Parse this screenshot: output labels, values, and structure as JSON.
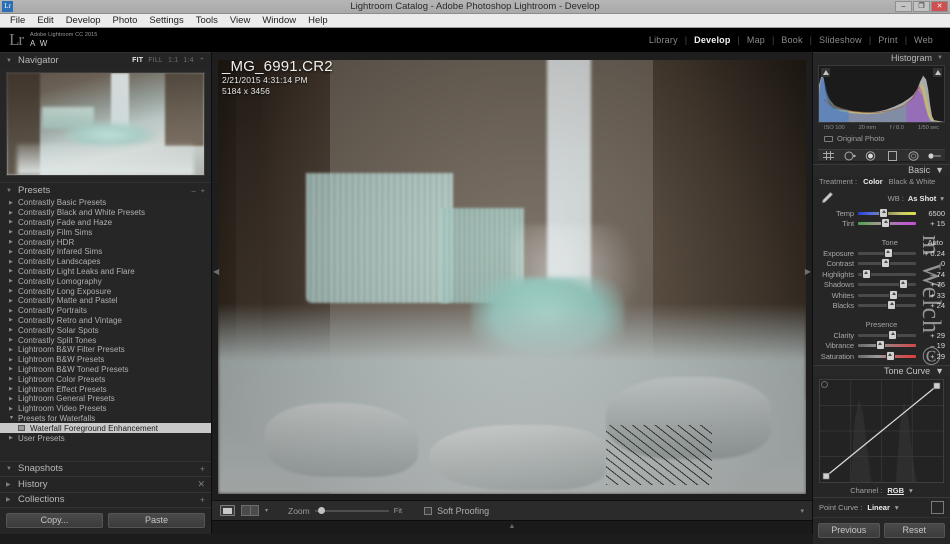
{
  "window": {
    "title": "Lightroom Catalog - Adobe Photoshop Lightroom - Develop",
    "app_icon": "Lr",
    "minimize": "–",
    "maximize": "❐",
    "close": "✕"
  },
  "menubar": {
    "items": [
      "File",
      "Edit",
      "Develop",
      "Photo",
      "Settings",
      "Tools",
      "View",
      "Window",
      "Help"
    ]
  },
  "identity": {
    "logo": "Lr",
    "line1": "Adobe Lightroom CC 2015",
    "line2": "A W"
  },
  "modules": {
    "items": [
      "Library",
      "Develop",
      "Map",
      "Book",
      "Slideshow",
      "Print",
      "Web"
    ],
    "active": "Develop",
    "separator": "|"
  },
  "navigator": {
    "title": "Navigator",
    "triangle": "▼",
    "zoom_levels": [
      "FIT",
      "FILL",
      "1:1",
      "1:4"
    ],
    "active_zoom": "FIT",
    "caret": "⌃"
  },
  "presets": {
    "title": "Presets",
    "triangle": "▼",
    "minus": "–",
    "plus": "+",
    "items": [
      {
        "label": "Contrastly Basic Presets",
        "open": false,
        "selected": false
      },
      {
        "label": "Contrastly Black and White Presets",
        "open": false,
        "selected": false
      },
      {
        "label": "Contrastly Fade and Haze",
        "open": false,
        "selected": false
      },
      {
        "label": "Contrastly Film Sims",
        "open": false,
        "selected": false
      },
      {
        "label": "Contrastly HDR",
        "open": false,
        "selected": false
      },
      {
        "label": "Contrastly Infared Sims",
        "open": false,
        "selected": false
      },
      {
        "label": "Contrastly Landscapes",
        "open": false,
        "selected": false
      },
      {
        "label": "Contrastly Light Leaks and Flare",
        "open": false,
        "selected": false
      },
      {
        "label": "Contrastly Lomography",
        "open": false,
        "selected": false
      },
      {
        "label": "Contrastly Long Exposure",
        "open": false,
        "selected": false
      },
      {
        "label": "Contrastly Matte and Pastel",
        "open": false,
        "selected": false
      },
      {
        "label": "Contrastly Portraits",
        "open": false,
        "selected": false
      },
      {
        "label": "Contrastly Retro and Vintage",
        "open": false,
        "selected": false
      },
      {
        "label": "Contrastly Solar Spots",
        "open": false,
        "selected": false
      },
      {
        "label": "Contrastly Split Tones",
        "open": false,
        "selected": false
      },
      {
        "label": "Lightroom B&W Filter Presets",
        "open": false,
        "selected": false
      },
      {
        "label": "Lightroom B&W Presets",
        "open": false,
        "selected": false
      },
      {
        "label": "Lightroom B&W Toned Presets",
        "open": false,
        "selected": false
      },
      {
        "label": "Lightroom Color Presets",
        "open": false,
        "selected": false
      },
      {
        "label": "Lightroom Effect Presets",
        "open": false,
        "selected": false
      },
      {
        "label": "Lightroom General Presets",
        "open": false,
        "selected": false
      },
      {
        "label": "Lightroom Video Presets",
        "open": false,
        "selected": false
      },
      {
        "label": "Presets for Waterfalls",
        "open": true,
        "selected": false
      },
      {
        "label": "Waterfall Foreground Enhancement",
        "open": false,
        "selected": true
      },
      {
        "label": "User Presets",
        "open": false,
        "selected": false
      }
    ],
    "closed_triangle": "▶",
    "open_triangle": "▼"
  },
  "left_panels": [
    {
      "name": "Snapshots",
      "triangle": "▼",
      "action": "+"
    },
    {
      "name": "History",
      "triangle": "▶",
      "action": "✕"
    },
    {
      "name": "Collections",
      "triangle": "▶",
      "action": "+"
    }
  ],
  "left_footer": {
    "copy": "Copy...",
    "paste": "Paste"
  },
  "photo": {
    "filename": "_MG_6991.CR2",
    "datetime": "2/21/2015 4:31:14 PM",
    "dimensions": "5184 x 3456"
  },
  "toolbar": {
    "loupe_icon": "loupe-view-icon",
    "compare_icon": "compare-view-icon",
    "caret": "▾",
    "zoom_label": "Zoom",
    "zoom_value": "Fit",
    "soft_proofing": "Soft Proofing",
    "right_caret": "▾"
  },
  "histogram": {
    "title": "Histogram",
    "triangle": "▼",
    "exif": [
      "ISO 100",
      "20 mm",
      "f / 8.0",
      "1/50 sec"
    ],
    "original_photo": "Original Photo"
  },
  "tools": [
    "crop-overlay-icon",
    "spot-removal-icon",
    "red-eye-correction-icon",
    "graduated-filter-icon",
    "radial-filter-icon",
    "adjustment-brush-icon"
  ],
  "basic": {
    "title": "Basic",
    "triangle": "▼",
    "treatment_label": "Treatment :",
    "treatment_color": "Color",
    "treatment_bw": "Black & White",
    "wb_label": "WB :",
    "wb_value": "As Shot",
    "wb_caret": "▾",
    "wb_sliders": [
      {
        "name": "Temp",
        "value": "6500",
        "pos": 44,
        "track": "temp"
      },
      {
        "name": "Tint",
        "value": "+ 15",
        "pos": 48,
        "track": "tint"
      }
    ],
    "tone_label": "Tone",
    "auto_label": "Auto",
    "tone_sliders": [
      {
        "name": "Exposure",
        "value": "+ 0.24",
        "pos": 52
      },
      {
        "name": "Contrast",
        "value": "0",
        "pos": 48
      },
      {
        "name": "Highlights",
        "value": "– 74",
        "pos": 14
      },
      {
        "name": "Shadows",
        "value": "+ 76",
        "pos": 78
      },
      {
        "name": "Whites",
        "value": "+ 33",
        "pos": 62
      },
      {
        "name": "Blacks",
        "value": "+ 24",
        "pos": 58
      }
    ],
    "presence_label": "Presence",
    "presence_sliders": [
      {
        "name": "Clarity",
        "value": "+ 29",
        "pos": 60,
        "track": ""
      },
      {
        "name": "Vibrance",
        "value": "– 19",
        "pos": 38,
        "track": "vib"
      },
      {
        "name": "Saturation",
        "value": "+ 29",
        "pos": 56,
        "track": "sat"
      }
    ]
  },
  "tone_curve": {
    "title": "Tone Curve",
    "triangle": "▼",
    "channel_label": "Channel :",
    "channel_value": "RGB",
    "channel_caret": "▾",
    "point_curve_label": "Point Curve :",
    "point_curve_value": "Linear",
    "point_curve_caret": "▾"
  },
  "right_footer": {
    "previous": "Previous",
    "reset": "Reset"
  },
  "watermark": "m Welch ©",
  "colors": {
    "panel_bg": "#262626",
    "canvas_bg": "#1e1e1e",
    "accent_text": "#ededed",
    "muted_text": "#9a9a9a"
  }
}
